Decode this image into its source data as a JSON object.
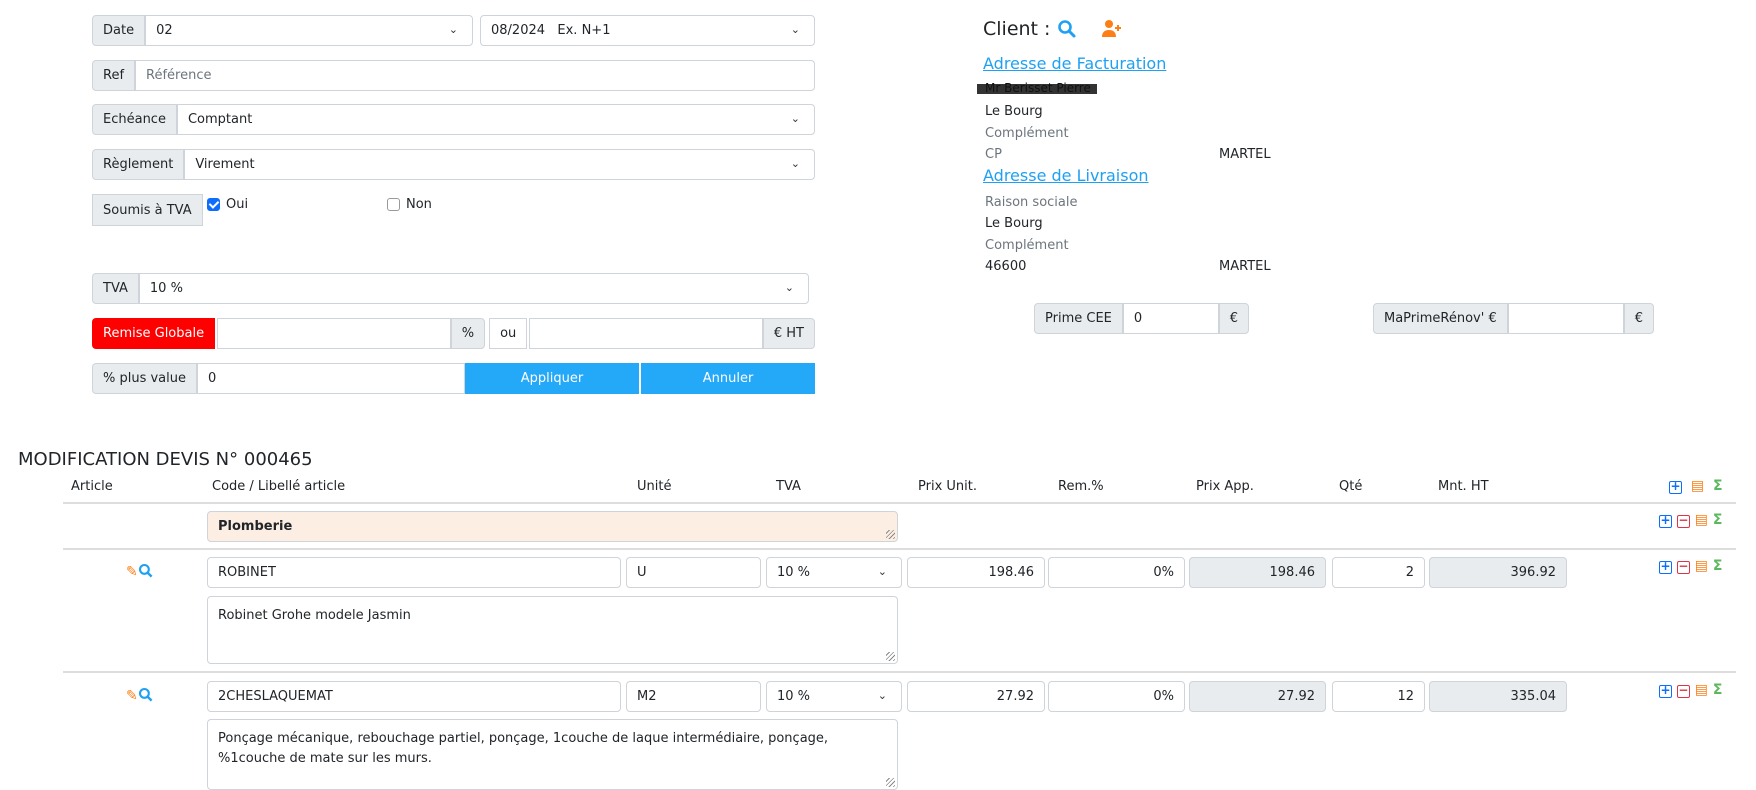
{
  "form": {
    "date_label": "Date",
    "date_day": "02",
    "date_period": "08/2024   Ex. N+1",
    "ref_label": "Ref",
    "ref_placeholder": "Référence",
    "echeance_label": "Echéance",
    "echeance_value": "Comptant",
    "reglement_label": "Règlement",
    "reglement_value": "Virement",
    "tva_subject_label": "Soumis à TVA",
    "oui": "Oui",
    "non": "Non",
    "oui_checked": true,
    "non_checked": false,
    "tva_label": "TVA",
    "tva_value": "10 %",
    "remise_label": "Remise Globale",
    "percent": "%",
    "ou": "ou",
    "eur_ht": "€ HT",
    "plus_value_label": "% plus value",
    "plus_value": "0",
    "apply": "Appliquer",
    "cancel": "Annuler"
  },
  "client": {
    "title": "Client :",
    "billing_link": "Adresse de Facturation",
    "billing": {
      "name": "Mr Berisset Pierre",
      "street": "Le Bourg",
      "complement": "Complément",
      "cp": "CP",
      "city": "MARTEL"
    },
    "delivery_link": "Adresse de Livraison",
    "delivery": {
      "company": "Raison sociale",
      "street": "Le Bourg",
      "complement": "Complément",
      "cp": "46600",
      "city": "MARTEL"
    },
    "prime_cee_label": "Prime CEE",
    "prime_cee": "0",
    "eur": "€",
    "maprime_label": "MaPrimeRénov' €",
    "maprime": ""
  },
  "quote": {
    "title": "MODIFICATION DEVIS N° 000465",
    "headers": [
      "Article",
      "Code / Libellé article",
      "Unité",
      "TVA",
      "Prix Unit.",
      "Rem.%",
      "Prix App.",
      "Qté",
      "Mnt. HT"
    ],
    "section": "Plomberie",
    "rows": [
      {
        "code": "ROBINET",
        "unit": "U",
        "tva": "10 %",
        "price": "198.46",
        "discount": "0%",
        "price_app": "198.46",
        "qty": "2",
        "amount": "396.92",
        "description": "Robinet Grohe modele Jasmin"
      },
      {
        "code": "2CHESLAQUEMAT",
        "unit": "M2",
        "tva": "10 %",
        "price": "27.92",
        "discount": "0%",
        "price_app": "27.92",
        "qty": "12",
        "amount": "335.04",
        "description": "Ponçage mécanique, rebouchage partiel, ponçage, 1couche de laque intermédiaire, ponçage, %1couche de mate sur les murs."
      }
    ]
  },
  "colors": {
    "accent": "#24a8f8",
    "remise": "#ff0000",
    "section_bg": "#fdeee3",
    "edit": "#fd7e14",
    "sum": "#5cb85c",
    "remove": "#dc3545",
    "add": "#0d6efd"
  }
}
